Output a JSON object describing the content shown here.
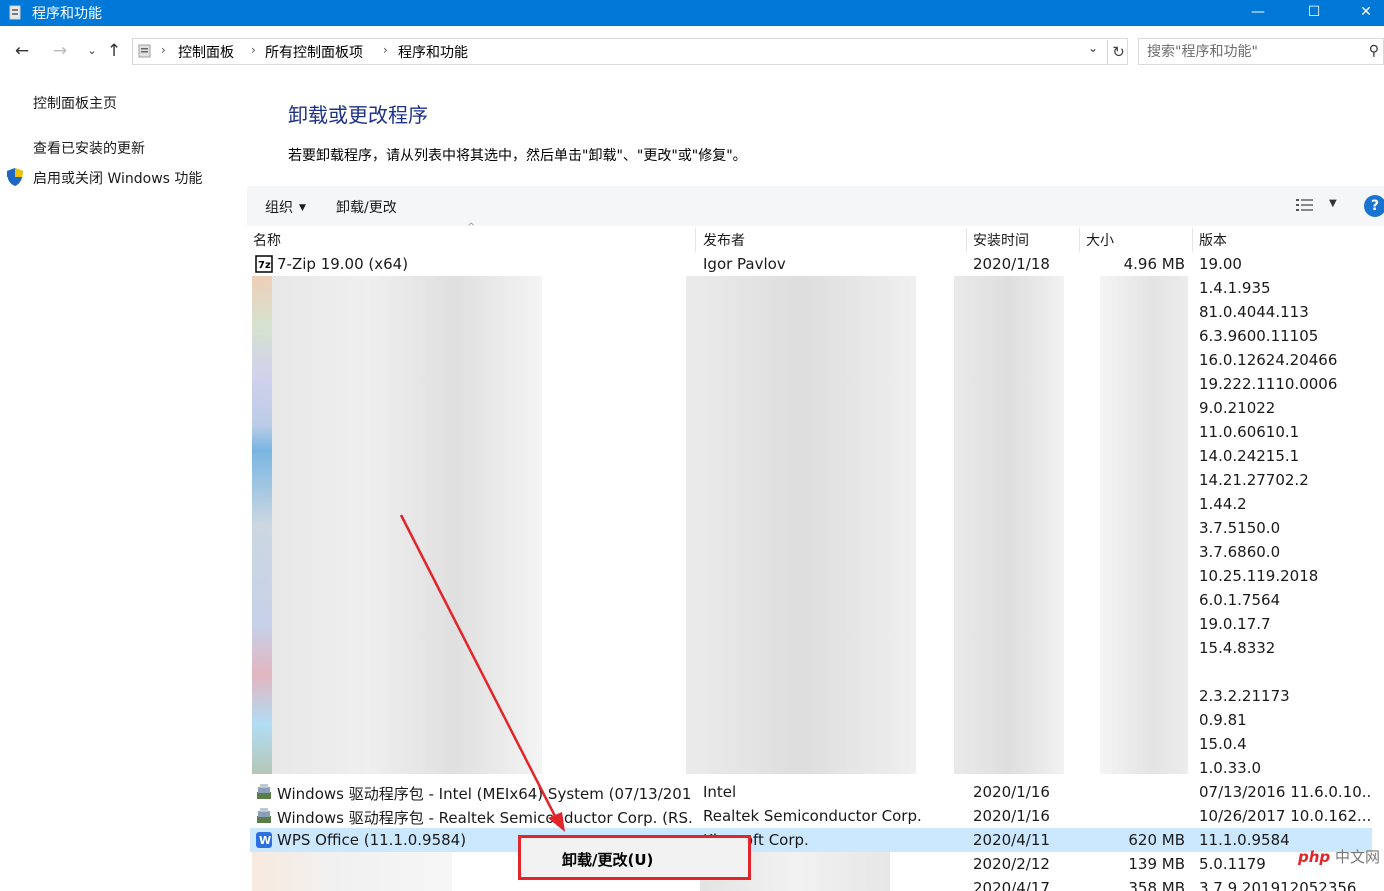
{
  "window": {
    "title": "程序和功能",
    "minimize": "—",
    "maximize": "☐",
    "close": "✕"
  },
  "nav": {
    "back": "←",
    "forward": "→",
    "recent": "⌄",
    "up": "↑",
    "breadcrumbs": [
      "控制面板",
      "所有控制面板项",
      "程序和功能"
    ],
    "search_placeholder": "搜索\"程序和功能\""
  },
  "sidebar": {
    "items": [
      {
        "label": "控制面板主页"
      },
      {
        "label": "查看已安装的更新"
      },
      {
        "label": "启用或关闭 Windows 功能"
      }
    ]
  },
  "main": {
    "heading": "卸载或更改程序",
    "description": "若要卸载程序，请从列表中将其选中，然后单击\"卸载\"、\"更改\"或\"修复\"。"
  },
  "toolbar": {
    "organize": "组织",
    "uninstall_change": "卸载/更改",
    "help": "?"
  },
  "columns": {
    "name": "名称",
    "publisher": "发布者",
    "installed": "安装时间",
    "size": "大小",
    "version": "版本"
  },
  "rows": [
    {
      "name": "7-Zip 19.00 (x64)",
      "publisher": "Igor Pavlov",
      "installed": "2020/1/18",
      "size": "4.96 MB",
      "version": "19.00"
    },
    {
      "name": "",
      "publisher": "",
      "installed": "",
      "size": "",
      "version": "1.4.1.935"
    },
    {
      "name": "",
      "publisher": "",
      "installed": "",
      "size": "",
      "version": "81.0.4044.113"
    },
    {
      "name": "",
      "publisher": "",
      "installed": "",
      "size": "",
      "version": "6.3.9600.11105"
    },
    {
      "name": "",
      "publisher": "",
      "installed": "",
      "size": "",
      "version": "16.0.12624.20466"
    },
    {
      "name": "",
      "publisher": "",
      "installed": "",
      "size": "",
      "version": "19.222.1110.0006"
    },
    {
      "name": "",
      "publisher": "",
      "installed": "",
      "size": "",
      "version": "9.0.21022"
    },
    {
      "name": "",
      "publisher": "",
      "installed": "",
      "size": "",
      "version": "11.0.60610.1"
    },
    {
      "name": "",
      "publisher": "",
      "installed": "",
      "size": "",
      "version": "14.0.24215.1"
    },
    {
      "name": "",
      "publisher": "",
      "installed": "",
      "size": "",
      "version": "14.21.27702.2"
    },
    {
      "name": "",
      "publisher": "",
      "installed": "",
      "size": "",
      "version": "1.44.2"
    },
    {
      "name": "",
      "publisher": "",
      "installed": "",
      "size": "",
      "version": "3.7.5150.0"
    },
    {
      "name": "",
      "publisher": "",
      "installed": "",
      "size": "",
      "version": "3.7.6860.0"
    },
    {
      "name": "",
      "publisher": "",
      "installed": "",
      "size": "",
      "version": "10.25.119.2018"
    },
    {
      "name": "",
      "publisher": "",
      "installed": "",
      "size": "",
      "version": "6.0.1.7564"
    },
    {
      "name": "",
      "publisher": "",
      "installed": "",
      "size": "",
      "version": "19.0.17.7"
    },
    {
      "name": "",
      "publisher": "",
      "installed": "",
      "size": "",
      "version": "15.4.8332"
    },
    {
      "name": "",
      "publisher": "",
      "installed": "",
      "size": "",
      "version": ""
    },
    {
      "name": "",
      "publisher": "",
      "installed": "",
      "size": "",
      "version": "2.3.2.21173"
    },
    {
      "name": "",
      "publisher": "",
      "installed": "",
      "size": "",
      "version": "0.9.81"
    },
    {
      "name": "",
      "publisher": "",
      "installed": "",
      "size": "",
      "version": "15.0.4"
    },
    {
      "name": "",
      "publisher": "",
      "installed": "",
      "size": "",
      "version": "1.0.33.0"
    },
    {
      "name": "Windows 驱动程序包 - Intel (MEIx64) System  (07/13/201...",
      "publisher": "Intel",
      "installed": "2020/1/16",
      "size": "",
      "version": "07/13/2016 11.6.0.10..."
    },
    {
      "name": "Windows 驱动程序包 - Realtek Semiconductor Corp. (RS...",
      "publisher": "Realtek Semiconductor Corp.",
      "installed": "2020/1/16",
      "size": "",
      "version": "10/26/2017 10.0.162..."
    },
    {
      "name": "WPS Office (11.1.0.9584)",
      "publisher": "Kingsoft Corp.",
      "installed": "2020/4/11",
      "size": "620 MB",
      "version": "11.1.0.9584"
    },
    {
      "name": "",
      "publisher": "",
      "installed": "2020/2/12",
      "size": "139 MB",
      "version": "5.0.1179"
    },
    {
      "name": "",
      "publisher": "",
      "installed": "2020/4/17",
      "size": "358 MB",
      "version": "3.7.9.201912052356"
    }
  ],
  "context_menu": {
    "uninstall_change": "卸载/更改(U)"
  },
  "watermark": {
    "brand": "php",
    "suffix": "中文网"
  },
  "colors": {
    "titlebar": "#0078d7",
    "heading": "#1e3287",
    "selected_row": "#cce8ff",
    "annotation_red": "#e1252a"
  }
}
